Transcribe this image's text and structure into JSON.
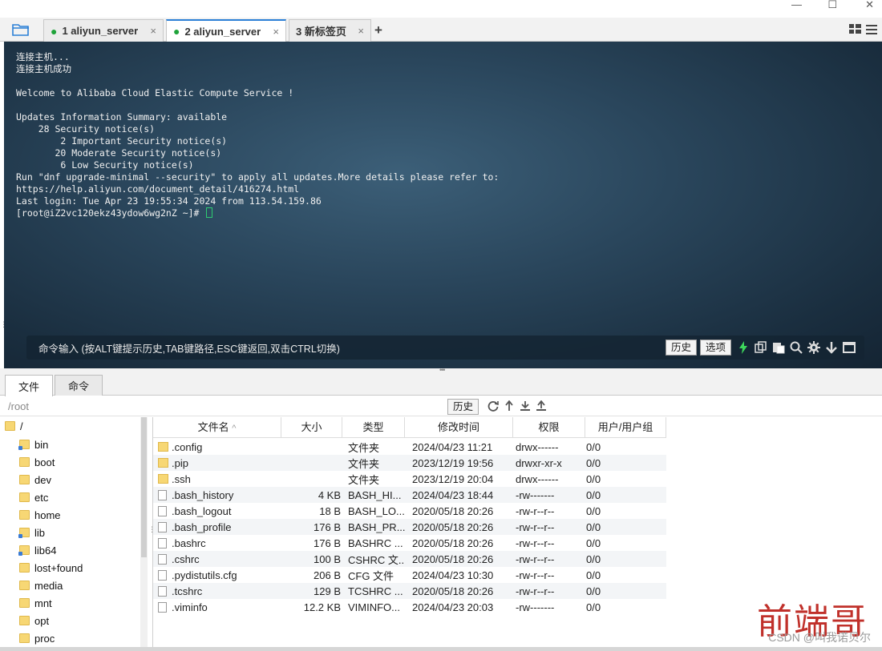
{
  "window": {
    "minimize": "—",
    "maximize": "☐",
    "close": "✕"
  },
  "tabs": [
    {
      "label": "1 aliyun_server",
      "connected": true,
      "active": false
    },
    {
      "label": "2 aliyun_server",
      "connected": true,
      "active": true
    },
    {
      "label": "3 新标签页",
      "connected": false,
      "active": false
    }
  ],
  "tab_close": "×",
  "tab_add": "+",
  "terminal": {
    "lines": "连接主机...\n连接主机成功\n\nWelcome to Alibaba Cloud Elastic Compute Service !\n\nUpdates Information Summary: available\n    28 Security notice(s)\n        2 Important Security notice(s)\n       20 Moderate Security notice(s)\n        6 Low Security notice(s)\nRun \"dnf upgrade-minimal --security\" to apply all updates.More details please refer to:\nhttps://help.aliyun.com/document_detail/416274.html\nLast login: Tue Apr 23 19:55:34 2024 from 113.54.159.86\n[root@iZ2vc120ekz43ydow6wg2nZ ~]# ",
    "cursor_color": "#2ecc71"
  },
  "cmdbar": {
    "hint": "命令输入 (按ALT键提示历史,TAB键路径,ESC键返回,双击CTRL切换)",
    "history_label": "历史",
    "options_label": "选项"
  },
  "bottom_tabs": [
    {
      "label": "文件",
      "active": true
    },
    {
      "label": "命令",
      "active": false
    }
  ],
  "pathbar": {
    "path": "/root",
    "history_label": "历史"
  },
  "tree": [
    {
      "name": "/",
      "link": false
    },
    {
      "name": "bin",
      "link": true
    },
    {
      "name": "boot",
      "link": false
    },
    {
      "name": "dev",
      "link": false
    },
    {
      "name": "etc",
      "link": false
    },
    {
      "name": "home",
      "link": false
    },
    {
      "name": "lib",
      "link": true
    },
    {
      "name": "lib64",
      "link": true
    },
    {
      "name": "lost+found",
      "link": false
    },
    {
      "name": "media",
      "link": false
    },
    {
      "name": "mnt",
      "link": false
    },
    {
      "name": "opt",
      "link": false
    },
    {
      "name": "proc",
      "link": false
    }
  ],
  "file_table": {
    "columns": [
      "文件名",
      "大小",
      "类型",
      "修改时间",
      "权限",
      "用户/用户组"
    ],
    "sort_indicator": "^",
    "rows": [
      {
        "name": ".config",
        "size": "",
        "type": "文件夹",
        "modified": "2024/04/23 11:21",
        "perm": "drwx------",
        "owner": "0/0",
        "folder": true
      },
      {
        "name": ".pip",
        "size": "",
        "type": "文件夹",
        "modified": "2023/12/19 19:56",
        "perm": "drwxr-xr-x",
        "owner": "0/0",
        "folder": true
      },
      {
        "name": ".ssh",
        "size": "",
        "type": "文件夹",
        "modified": "2023/12/19 20:04",
        "perm": "drwx------",
        "owner": "0/0",
        "folder": true
      },
      {
        "name": ".bash_history",
        "size": "4 KB",
        "type": "BASH_HI...",
        "modified": "2024/04/23 18:44",
        "perm": "-rw-------",
        "owner": "0/0",
        "folder": false
      },
      {
        "name": ".bash_logout",
        "size": "18 B",
        "type": "BASH_LO...",
        "modified": "2020/05/18 20:26",
        "perm": "-rw-r--r--",
        "owner": "0/0",
        "folder": false
      },
      {
        "name": ".bash_profile",
        "size": "176 B",
        "type": "BASH_PR...",
        "modified": "2020/05/18 20:26",
        "perm": "-rw-r--r--",
        "owner": "0/0",
        "folder": false
      },
      {
        "name": ".bashrc",
        "size": "176 B",
        "type": "BASHRC ...",
        "modified": "2020/05/18 20:26",
        "perm": "-rw-r--r--",
        "owner": "0/0",
        "folder": false
      },
      {
        "name": ".cshrc",
        "size": "100 B",
        "type": "CSHRC 文...",
        "modified": "2020/05/18 20:26",
        "perm": "-rw-r--r--",
        "owner": "0/0",
        "folder": false
      },
      {
        "name": ".pydistutils.cfg",
        "size": "206 B",
        "type": "CFG 文件",
        "modified": "2024/04/23 10:30",
        "perm": "-rw-r--r--",
        "owner": "0/0",
        "folder": false
      },
      {
        "name": ".tcshrc",
        "size": "129 B",
        "type": "TCSHRC ...",
        "modified": "2020/05/18 20:26",
        "perm": "-rw-r--r--",
        "owner": "0/0",
        "folder": false
      },
      {
        "name": ".viminfo",
        "size": "12.2 KB",
        "type": "VIMINFO...",
        "modified": "2024/04/23 20:03",
        "perm": "-rw-------",
        "owner": "0/0",
        "folder": false
      }
    ]
  },
  "watermark": {
    "title": "前端哥",
    "credit": "CSDN @叫我诺贝尔"
  }
}
